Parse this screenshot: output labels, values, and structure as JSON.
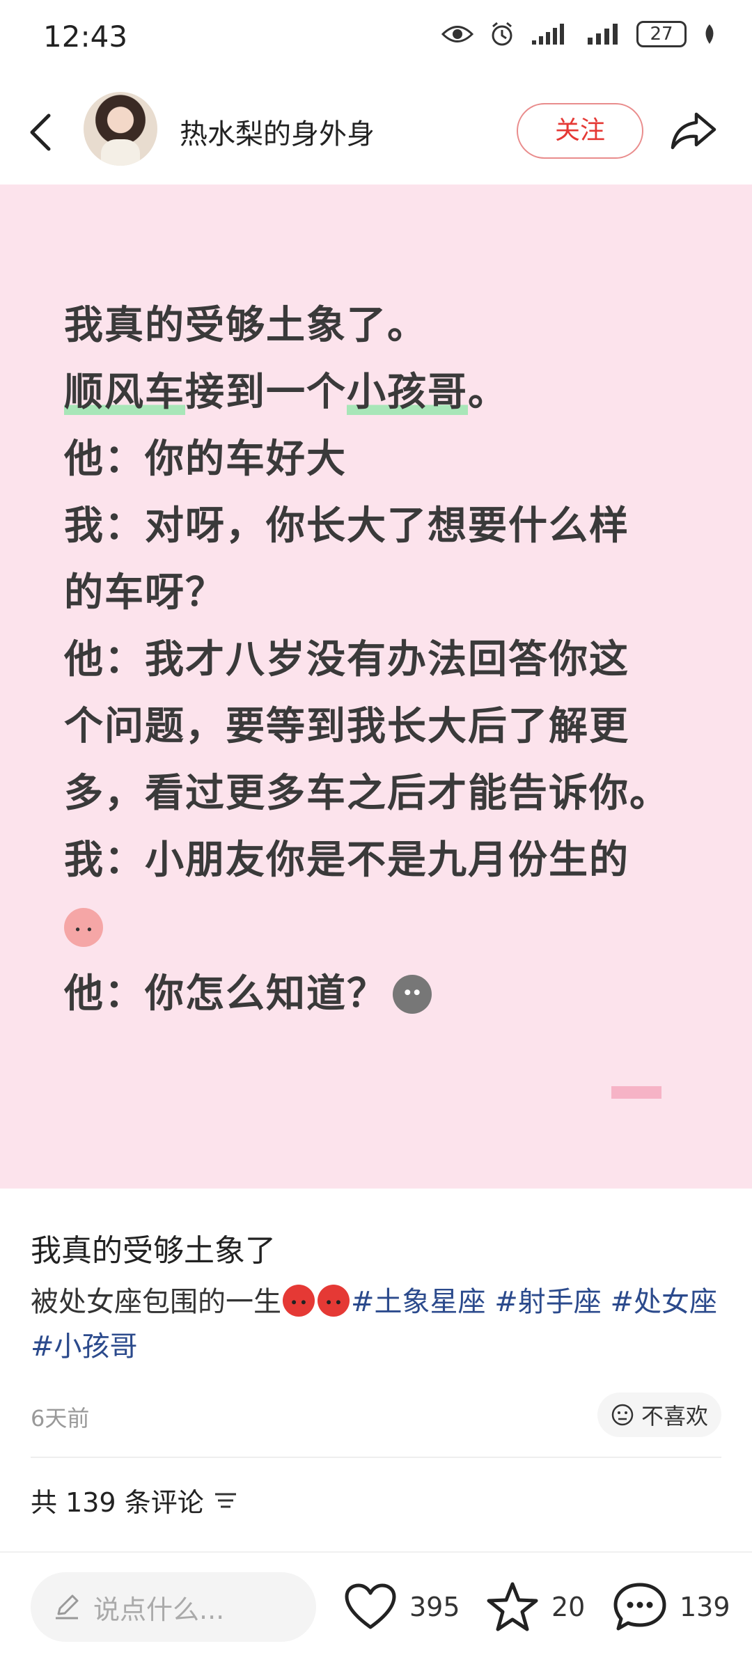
{
  "status_bar": {
    "time": "12:43",
    "battery": "27",
    "icons": [
      "eye-icon",
      "alarm-icon",
      "signal-icon",
      "signal-icon",
      "battery-icon",
      "leaf-icon"
    ]
  },
  "header": {
    "back_icon": "chevron-left-icon",
    "author_name": "热水梨的身外身",
    "follow_label": "关注",
    "share_icon": "share-icon"
  },
  "post_image": {
    "background_color": "#fce3ec",
    "lines": [
      {
        "pre": "我真的受够土象了。",
        "hl1": "",
        "mid": "",
        "hl2": "",
        "post": ""
      },
      {
        "pre": "",
        "hl1": "顺风车",
        "mid": "接到一个",
        "hl2": "小孩哥",
        "post": "。"
      },
      {
        "pre": "他：你的车好大",
        "hl1": "",
        "mid": "",
        "hl2": "",
        "post": ""
      },
      {
        "pre": "我：对呀，你长大了想要什么样",
        "hl1": "",
        "mid": "",
        "hl2": "",
        "post": ""
      },
      {
        "pre": "的车呀？",
        "hl1": "",
        "mid": "",
        "hl2": "",
        "post": ""
      },
      {
        "pre": "他：我才八岁没有办法回答你这",
        "hl1": "",
        "mid": "",
        "hl2": "",
        "post": ""
      },
      {
        "pre": "个问题，要等到我长大后了解更",
        "hl1": "",
        "mid": "",
        "hl2": "",
        "post": ""
      },
      {
        "pre": "多，看过更多车之后才能告诉你。",
        "hl1": "",
        "mid": "",
        "hl2": "",
        "post": ""
      },
      {
        "pre": "我：小朋友你是不是九月份生的",
        "hl1": "",
        "mid": "",
        "hl2": "",
        "post": ""
      },
      {
        "pre": "",
        "hl1": "",
        "mid": "",
        "hl2": "",
        "post": "",
        "emoji": "pig-sweat-emoji"
      },
      {
        "pre": "他：你怎么知道？",
        "hl1": "",
        "mid": "",
        "hl2": "",
        "post": "",
        "emoji": "stone-face-emoji"
      }
    ]
  },
  "caption": {
    "title": "我真的受够土象了",
    "body_prefix": "被处女座包围的一生",
    "emojis": [
      "angry-face-emoji",
      "angry-face-emoji"
    ],
    "tags": [
      "#土象星座",
      "#射手座",
      "#处女座",
      "#小孩哥"
    ]
  },
  "meta": {
    "time_ago": "6天前",
    "dislike_label": "不喜欢",
    "comments_summary": "共 139 条评论"
  },
  "bottom_bar": {
    "input_placeholder": "说点什么...",
    "likes": "395",
    "favorites": "20",
    "comments": "139"
  }
}
